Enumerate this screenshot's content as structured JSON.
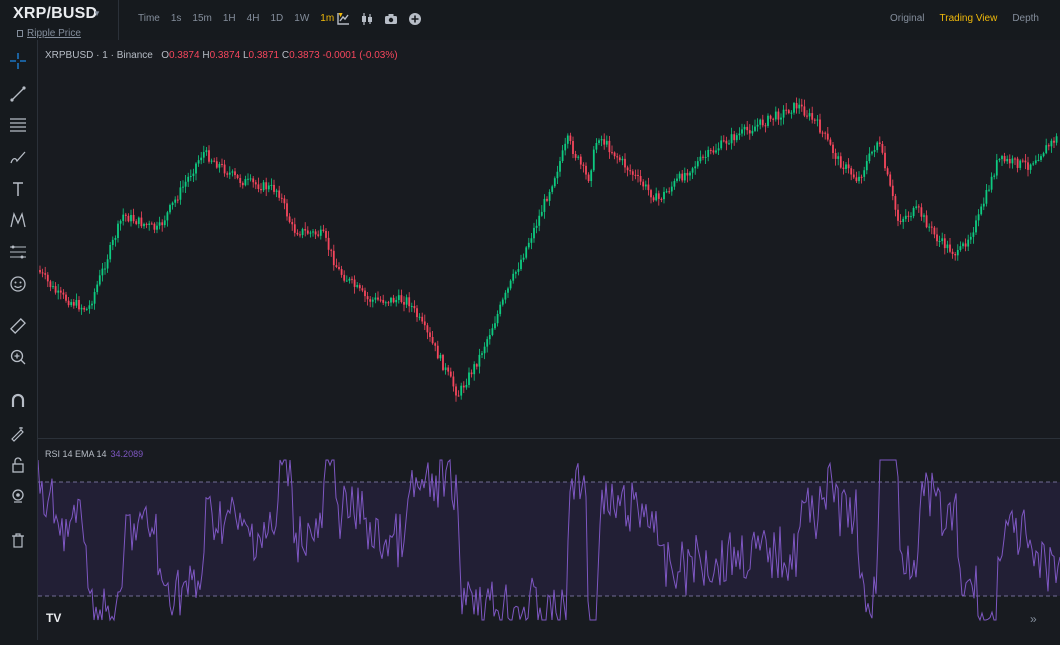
{
  "header": {
    "symbol": "XRP/BUSD",
    "subtitle": "Ripple Price",
    "intervals": [
      {
        "label": "Time",
        "active": false
      },
      {
        "label": "1s",
        "active": false
      },
      {
        "label": "15m",
        "active": false
      },
      {
        "label": "1H",
        "active": false
      },
      {
        "label": "4H",
        "active": false
      },
      {
        "label": "1D",
        "active": false
      },
      {
        "label": "1W",
        "active": false
      },
      {
        "label": "1m",
        "active": true
      }
    ],
    "views": [
      {
        "label": "Original",
        "active": false
      },
      {
        "label": "Trading View",
        "active": true
      },
      {
        "label": "Depth",
        "active": false
      }
    ]
  },
  "legend": {
    "pair": "XRPBUSD",
    "interval": "1",
    "exchange": "Binance",
    "o_label": "O",
    "o": "0.3874",
    "h_label": "H",
    "h": "0.3874",
    "l_label": "L",
    "l": "0.3871",
    "c_label": "C",
    "c": "0.3873",
    "change": "-0.0001 (-0.03%)"
  },
  "rsi": {
    "label": "RSI 14 EMA 14",
    "value": "34.2089"
  },
  "colors": {
    "up": "#0ecb81",
    "down": "#f6465d",
    "rsi": "#7e57c2",
    "accent": "#f0b90b"
  },
  "icons": {
    "top": [
      "chart-settings-icon",
      "candle-type-icon",
      "screenshot-icon",
      "add-icon"
    ],
    "left": [
      "crosshair-icon",
      "trendline-icon",
      "fib-icon",
      "brush-icon",
      "text-icon",
      "pattern-icon",
      "forecast-icon",
      "emoji-icon",
      "ruler-icon",
      "zoom-icon",
      "magnet-icon",
      "lock-drawing-icon",
      "lock-icon",
      "eye-icon",
      "trash-icon"
    ]
  },
  "logo": "TV"
}
